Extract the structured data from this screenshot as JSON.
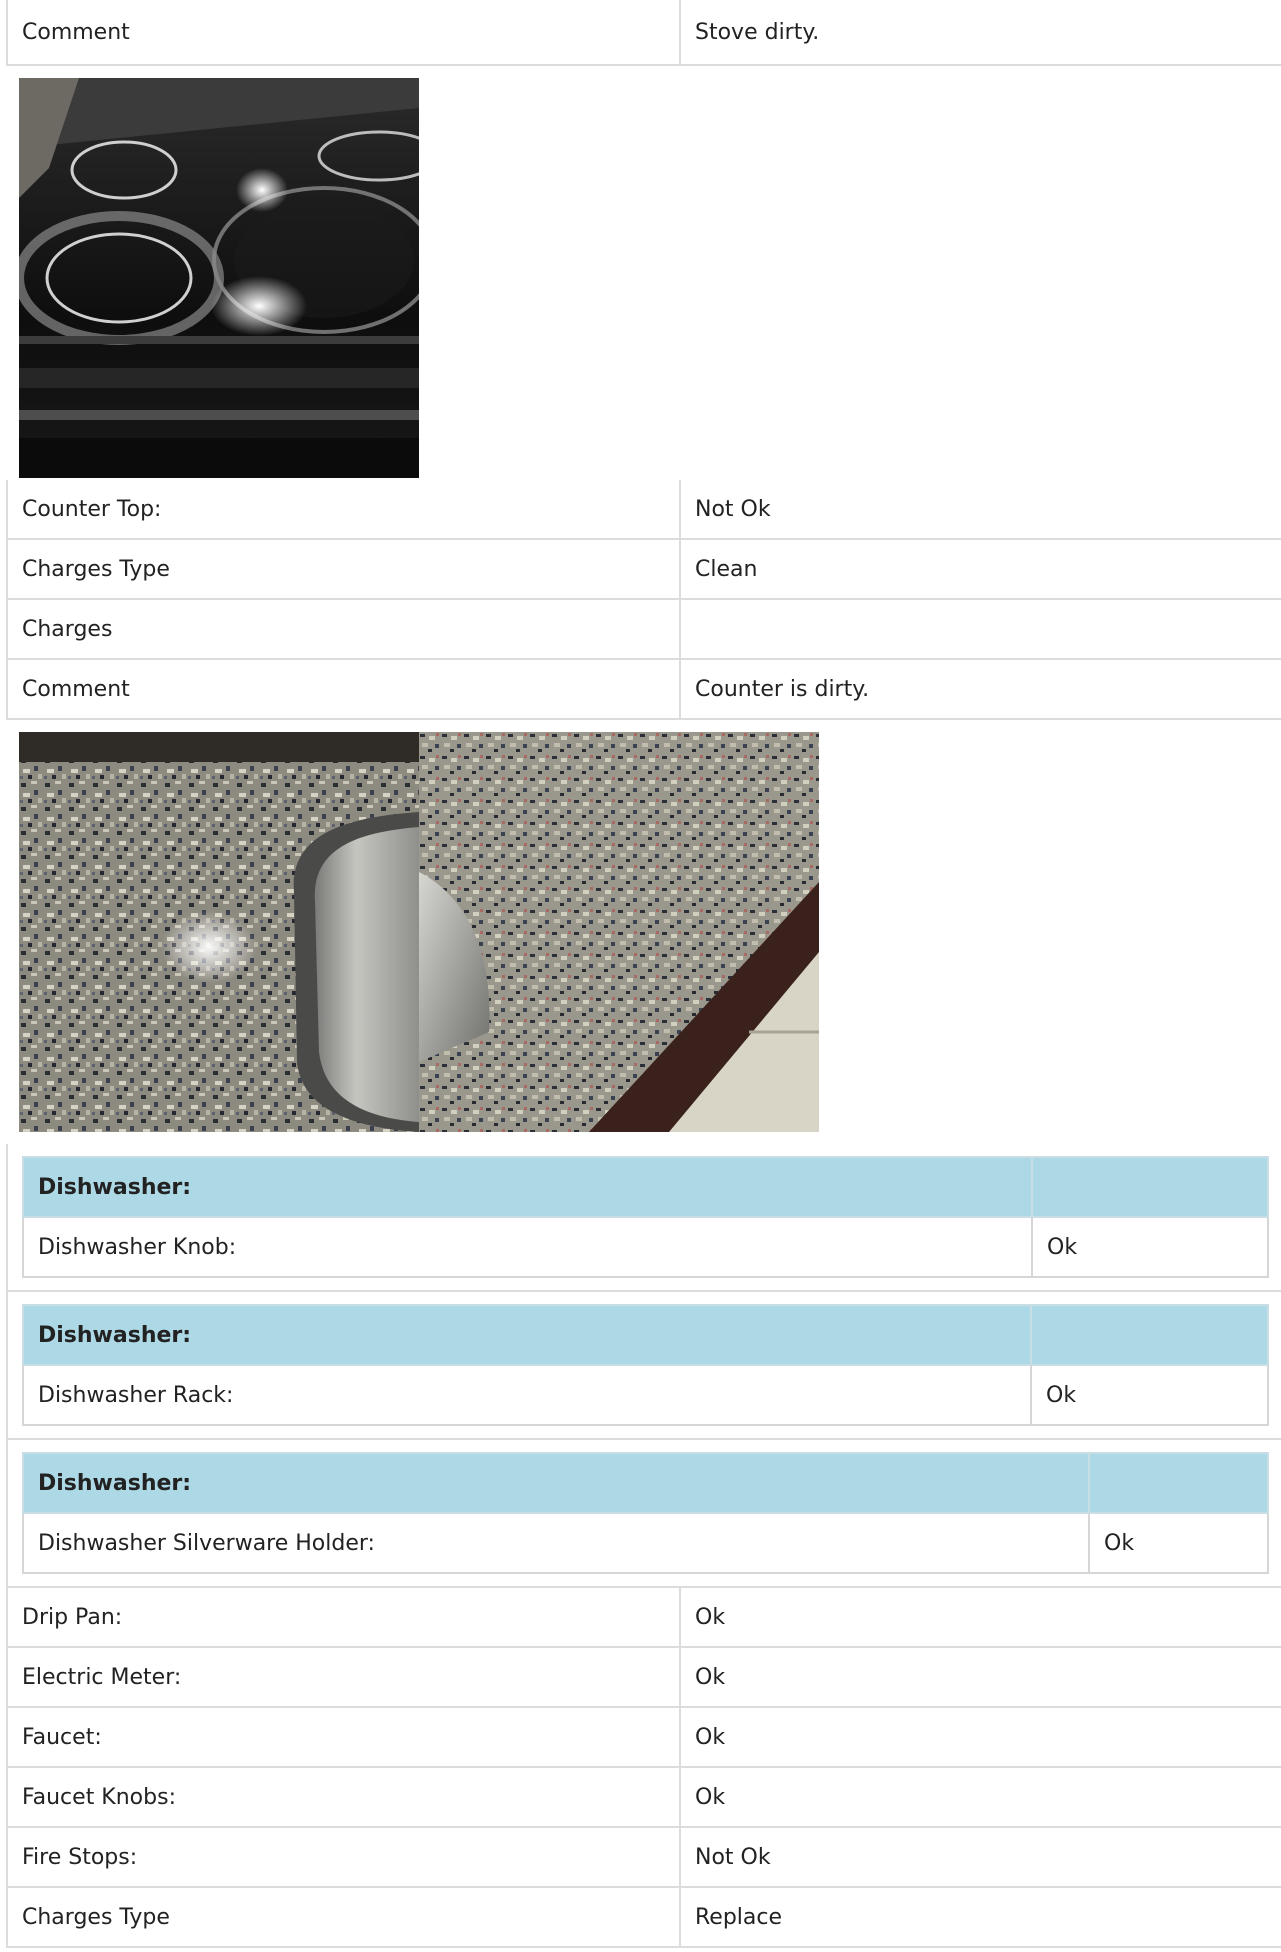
{
  "stove_comment": {
    "label": "Comment",
    "value": "Stove dirty."
  },
  "counter_rows": [
    {
      "label": "Counter Top:",
      "value": "Not Ok"
    },
    {
      "label": "Charges Type",
      "value": "Clean"
    },
    {
      "label": "Charges",
      "value": ""
    },
    {
      "label": "Comment",
      "value": "Counter is dirty."
    }
  ],
  "dishwasher_groups": [
    {
      "header": "Dishwasher:",
      "item": "Dishwasher Knob:",
      "value": "Ok"
    },
    {
      "header": "Dishwasher:",
      "item": "Dishwasher Rack:",
      "value": "Ok"
    },
    {
      "header": "Dishwasher:",
      "item": "Dishwasher Silverware Holder:",
      "value": "Ok"
    }
  ],
  "bottom_rows": [
    {
      "label": "Drip Pan:",
      "value": "Ok"
    },
    {
      "label": "Electric Meter:",
      "value": "Ok"
    },
    {
      "label": "Faucet:",
      "value": "Ok"
    },
    {
      "label": "Faucet Knobs:",
      "value": "Ok"
    },
    {
      "label": "Fire Stops:",
      "value": "Not Ok"
    },
    {
      "label": "Charges Type",
      "value": "Replace"
    }
  ],
  "colors": {
    "group_header_bg": "#add8e6",
    "border": "#dcdcdc"
  }
}
